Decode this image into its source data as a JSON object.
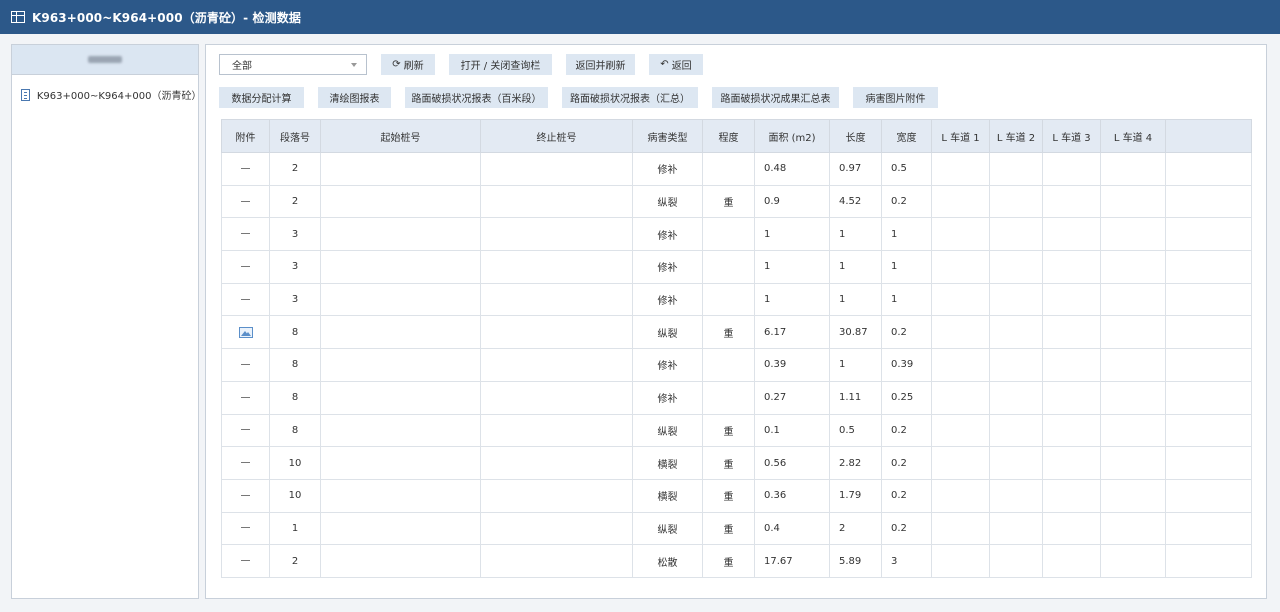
{
  "window": {
    "title": "K963+000~K964+000（沥青砼）- 检测数据"
  },
  "sidebar": {
    "tree_items": [
      {
        "label": "K963+000~K964+000（沥青砼）"
      }
    ]
  },
  "toolbar": {
    "filter_value": "全部",
    "refresh_label": "刷新",
    "toggle_query_label": "打开 / 关闭查询栏",
    "return_refresh_label": "返回并刷新",
    "back_label": "返回",
    "data_alloc_label": "数据分配计算",
    "sketch_report_label": "清绘图报表",
    "damage_report_100m_label": "路面破损状况报表（百米段）",
    "damage_report_summary_label": "路面破损状况报表（汇总）",
    "damage_result_summary_label": "路面破损状况成果汇总表",
    "disease_image_attach_label": "病害图片附件"
  },
  "table": {
    "headers": [
      "附件",
      "段落号",
      "起始桩号",
      "终止桩号",
      "病害类型",
      "程度",
      "面积 (m2)",
      "长度",
      "宽度",
      "L 车道 1",
      "L 车道 2",
      "L 车道 3",
      "L 车道 4",
      ""
    ],
    "rows": [
      {
        "attach": "—",
        "seg": "2",
        "start": "",
        "end": "",
        "type": "修补",
        "level": "",
        "area": "0.48",
        "length": "0.97",
        "width": "0.5",
        "l1": "",
        "l2": "",
        "l3": "",
        "l4": ""
      },
      {
        "attach": "—",
        "seg": "2",
        "start": "",
        "end": "",
        "type": "纵裂",
        "level": "重",
        "area": "0.9",
        "length": "4.52",
        "width": "0.2",
        "l1": "",
        "l2": "",
        "l3": "",
        "l4": ""
      },
      {
        "attach": "—",
        "seg": "3",
        "start": "",
        "end": "",
        "type": "修补",
        "level": "",
        "area": "1",
        "length": "1",
        "width": "1",
        "l1": "",
        "l2": "",
        "l3": "",
        "l4": ""
      },
      {
        "attach": "—",
        "seg": "3",
        "start": "",
        "end": "",
        "type": "修补",
        "level": "",
        "area": "1",
        "length": "1",
        "width": "1",
        "l1": "",
        "l2": "",
        "l3": "",
        "l4": ""
      },
      {
        "attach": "—",
        "seg": "3",
        "start": "",
        "end": "",
        "type": "修补",
        "level": "",
        "area": "1",
        "length": "1",
        "width": "1",
        "l1": "",
        "l2": "",
        "l3": "",
        "l4": ""
      },
      {
        "attach": "image",
        "seg": "8",
        "start": "",
        "end": "",
        "type": "纵裂",
        "level": "重",
        "area": "6.17",
        "length": "30.87",
        "width": "0.2",
        "l1": "",
        "l2": "",
        "l3": "",
        "l4": ""
      },
      {
        "attach": "—",
        "seg": "8",
        "start": "",
        "end": "",
        "type": "修补",
        "level": "",
        "area": "0.39",
        "length": "1",
        "width": "0.39",
        "l1": "",
        "l2": "",
        "l3": "",
        "l4": ""
      },
      {
        "attach": "—",
        "seg": "8",
        "start": "",
        "end": "",
        "type": "修补",
        "level": "",
        "area": "0.27",
        "length": "1.11",
        "width": "0.25",
        "l1": "",
        "l2": "",
        "l3": "",
        "l4": ""
      },
      {
        "attach": "—",
        "seg": "8",
        "start": "",
        "end": "",
        "type": "纵裂",
        "level": "重",
        "area": "0.1",
        "length": "0.5",
        "width": "0.2",
        "l1": "",
        "l2": "",
        "l3": "",
        "l4": ""
      },
      {
        "attach": "—",
        "seg": "10",
        "start": "",
        "end": "",
        "type": "横裂",
        "level": "重",
        "area": "0.56",
        "length": "2.82",
        "width": "0.2",
        "l1": "",
        "l2": "",
        "l3": "",
        "l4": ""
      },
      {
        "attach": "—",
        "seg": "10",
        "start": "",
        "end": "",
        "type": "横裂",
        "level": "重",
        "area": "0.36",
        "length": "1.79",
        "width": "0.2",
        "l1": "",
        "l2": "",
        "l3": "",
        "l4": ""
      },
      {
        "attach": "—",
        "seg": "1",
        "start": "",
        "end": "",
        "type": "纵裂",
        "level": "重",
        "area": "0.4",
        "length": "2",
        "width": "0.2",
        "l1": "",
        "l2": "",
        "l3": "",
        "l4": ""
      },
      {
        "attach": "—",
        "seg": "2",
        "start": "",
        "end": "",
        "type": "松散",
        "level": "重",
        "area": "17.67",
        "length": "5.89",
        "width": "3",
        "l1": "",
        "l2": "",
        "l3": "",
        "l4": ""
      }
    ]
  },
  "icons": {
    "title_icon": "table-icon",
    "tree_icon": "document-icon",
    "refresh_icon": "refresh-icon",
    "back_icon": "undo-icon",
    "attachment_icon": "image-icon"
  },
  "colors": {
    "titlebar": "#2c5889",
    "button_bg": "#dde7f2",
    "header_bg": "#e3eaf3",
    "panel_border": "#c8d0da"
  }
}
